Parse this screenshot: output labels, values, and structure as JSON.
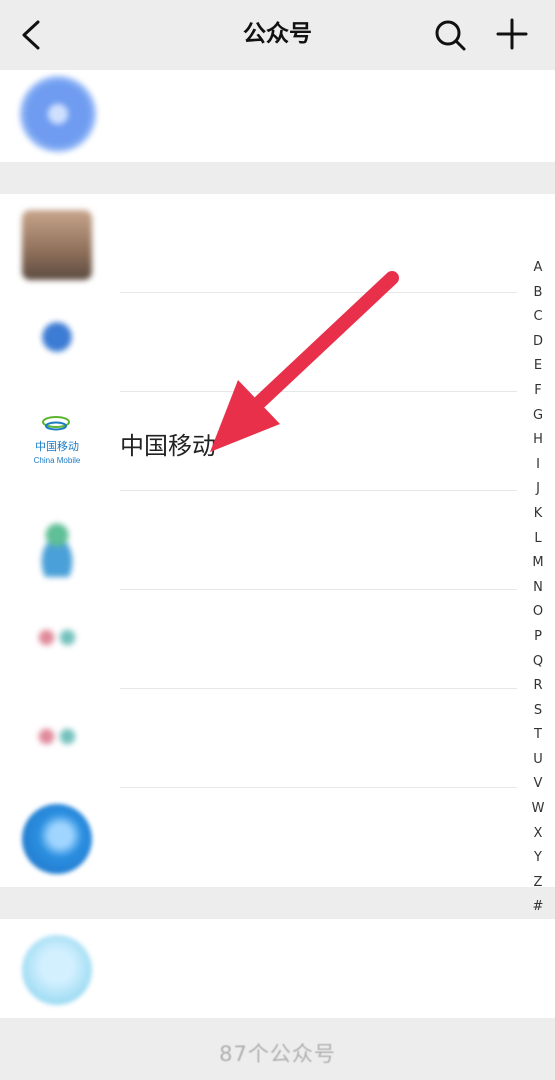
{
  "header": {
    "title": "公众号",
    "back_icon": "back-icon",
    "search_icon": "search-icon",
    "add_icon": "plus-icon"
  },
  "sections": [
    {
      "rows": [
        {
          "name": "",
          "icon": "account-avatar",
          "blurred": true
        }
      ]
    },
    {
      "rows": [
        {
          "name": "",
          "icon": "account-avatar",
          "blurred": true
        },
        {
          "name": "",
          "icon": "account-avatar",
          "blurred": true
        },
        {
          "name": "中国移动",
          "icon": "china-mobile-logo",
          "blurred": false,
          "logo_text_cn": "中国移动",
          "logo_text_en": "China Mobile"
        },
        {
          "name": "",
          "icon": "account-avatar",
          "blurred": true
        },
        {
          "name": "",
          "icon": "account-avatar",
          "blurred": true
        },
        {
          "name": "",
          "icon": "account-avatar",
          "blurred": true
        },
        {
          "name": "",
          "icon": "account-avatar",
          "blurred": true
        }
      ]
    },
    {
      "rows": [
        {
          "name": "",
          "icon": "account-avatar",
          "blurred": true
        }
      ]
    }
  ],
  "index_letters": [
    "A",
    "B",
    "C",
    "D",
    "E",
    "F",
    "G",
    "H",
    "I",
    "J",
    "K",
    "L",
    "M",
    "N",
    "O",
    "P",
    "Q",
    "R",
    "S",
    "T",
    "U",
    "V",
    "W",
    "X",
    "Y",
    "Z",
    "#"
  ],
  "footer": {
    "count_text": "87个公众号"
  },
  "annotation": {
    "type": "red-arrow",
    "color": "#e8304a"
  },
  "colors": {
    "background": "#ededed",
    "row_background": "#ffffff",
    "china_mobile_blue": "#1a7bc4",
    "china_mobile_green": "#5cb531"
  }
}
